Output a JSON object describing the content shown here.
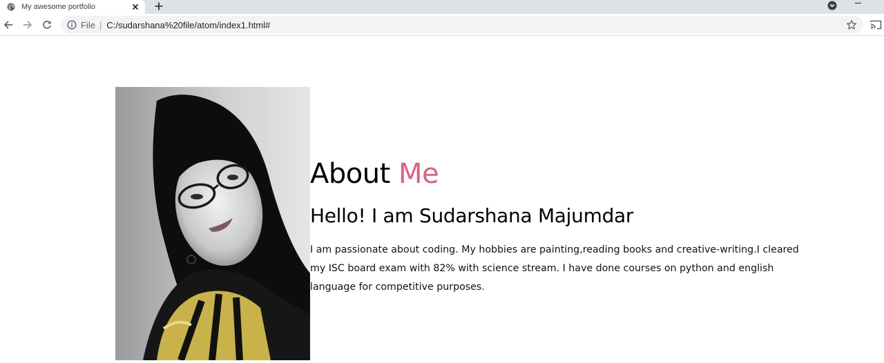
{
  "browser": {
    "tab_title": "My awesome portfolio",
    "url_scheme_label": "File",
    "url": "C:/sudarshana%20file/atom/index1.html#"
  },
  "about": {
    "heading_part1": "About",
    "heading_accent": "Me",
    "greeting": "Hello! I am Sudarshana Majumdar",
    "bio": "I am passionate about coding. My hobbies are painting,reading books and creative-writing.I cleared my ISC board exam with 82% with science stream. I have done courses on python and english language for competitive purposes."
  },
  "colors": {
    "accent": "#e0607e",
    "tabstrip": "#dee1e6",
    "omnibox": "#f1f3f4"
  },
  "icons": {
    "favicon": "globe-icon",
    "tab_close": "close-icon",
    "new_tab": "plus-icon",
    "tab_search": "tab-search-icon",
    "back": "arrow-left-icon",
    "forward": "arrow-right-icon",
    "reload": "reload-icon",
    "site_info": "info-icon",
    "bookmark": "star-icon",
    "cast": "cast-icon"
  }
}
